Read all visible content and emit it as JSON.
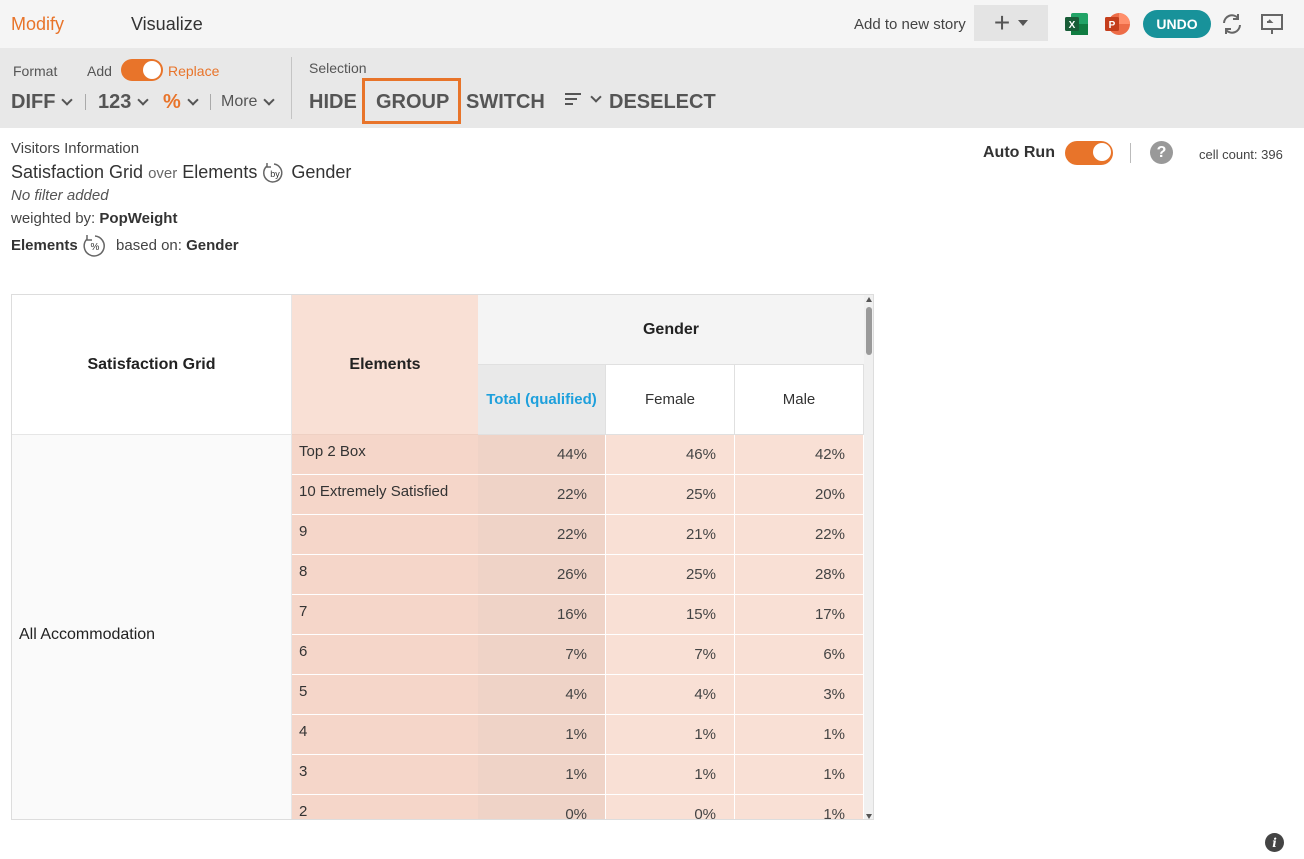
{
  "tabs": {
    "modify": "Modify",
    "visualize": "Visualize"
  },
  "story": {
    "add_label": "Add to new story"
  },
  "undo_label": "UNDO",
  "toolbar": {
    "format_label": "Format",
    "add_label": "Add",
    "replace_label": "Replace",
    "diff_label": "DIFF",
    "num_label": "123",
    "pct_label": "%",
    "more_label": "More",
    "selection_label": "Selection",
    "hide_label": "HIDE",
    "group_label": "GROUP",
    "switch_label": "SWITCH",
    "deselect_label": "DESELECT"
  },
  "info": {
    "dataset": "Visitors Information",
    "row_var": "Satisfaction Grid",
    "over": "over",
    "col_var1": "Elements",
    "by_icon": "by",
    "col_var2": "Gender",
    "filter": "No filter added",
    "weighted_prefix": "weighted by:",
    "weight": "PopWeight",
    "pct_var": "Elements",
    "pct_icon": "%",
    "based_prefix": "based on:",
    "based_var": "Gender"
  },
  "autorun": {
    "label": "Auto Run",
    "help": "?",
    "cell_count": "cell count: 396"
  },
  "grid": {
    "header_row_var": "Satisfaction Grid",
    "header_elements": "Elements",
    "header_gender": "Gender",
    "columns": [
      "Total (qualified)",
      "Female",
      "Male"
    ],
    "row_label": "All Accommodation",
    "rows": [
      {
        "label": "Top 2 Box",
        "total": "44%",
        "female": "46%",
        "male": "42%"
      },
      {
        "label": "10 Extremely Satisfied",
        "total": "22%",
        "female": "25%",
        "male": "20%"
      },
      {
        "label": "9",
        "total": "22%",
        "female": "21%",
        "male": "22%"
      },
      {
        "label": "8",
        "total": "26%",
        "female": "25%",
        "male": "28%"
      },
      {
        "label": "7",
        "total": "16%",
        "female": "15%",
        "male": "17%"
      },
      {
        "label": "6",
        "total": "7%",
        "female": "7%",
        "male": "6%"
      },
      {
        "label": "5",
        "total": "4%",
        "female": "4%",
        "male": "3%"
      },
      {
        "label": "4",
        "total": "1%",
        "female": "1%",
        "male": "1%"
      },
      {
        "label": "3",
        "total": "1%",
        "female": "1%",
        "male": "1%"
      },
      {
        "label": "2",
        "total": "0%",
        "female": "0%",
        "male": "1%"
      }
    ]
  },
  "colors": {
    "accent": "#e8742a",
    "undo": "#18929a",
    "total_header": "#1ea0dc"
  },
  "info_icon": "i"
}
